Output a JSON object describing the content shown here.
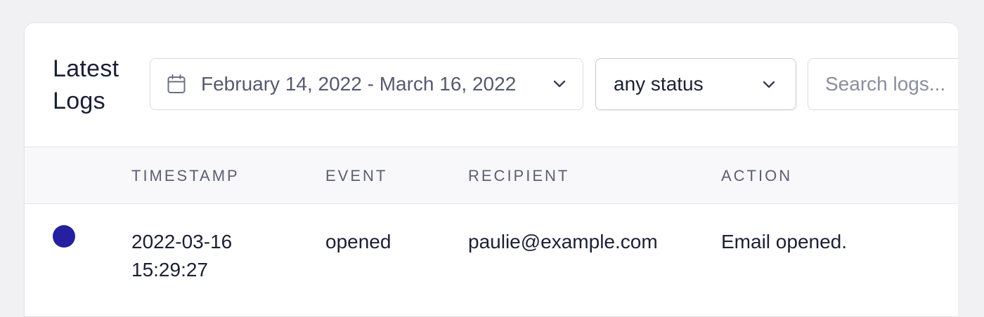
{
  "header": {
    "title": "Latest Logs"
  },
  "filters": {
    "date_range": {
      "value": "February 14, 2022 - March 16, 2022",
      "icon": "calendar-icon"
    },
    "status": {
      "selected": "any status",
      "icon": "chevron-down-icon"
    },
    "search": {
      "placeholder": "Search logs...",
      "value": ""
    }
  },
  "table": {
    "columns": [
      "TIMESTAMP",
      "EVENT",
      "RECIPIENT",
      "ACTION"
    ],
    "rows": [
      {
        "status_color": "#25209f",
        "timestamp": "2022-03-16 15:29:27",
        "event": "opened",
        "recipient": "paulie@example.com",
        "action": "Email opened."
      }
    ]
  },
  "colors": {
    "page_background": "#f1f1f3",
    "card_background": "#ffffff",
    "header_background": "#f8f8fa",
    "status_opened": "#25209f"
  }
}
